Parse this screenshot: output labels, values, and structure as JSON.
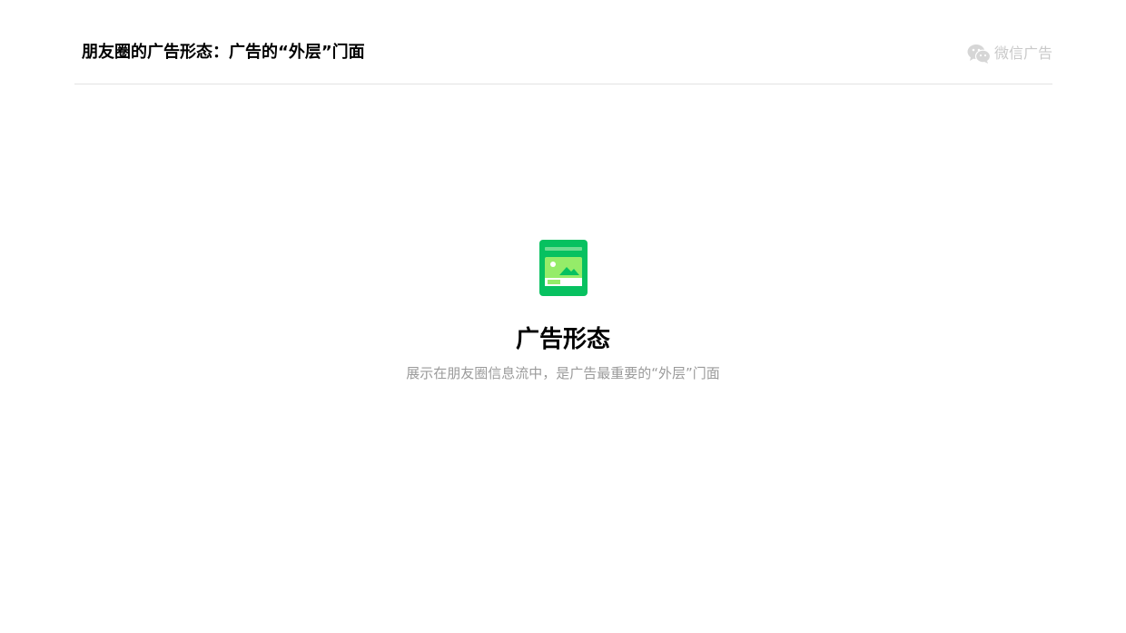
{
  "header": {
    "title": "朋友圈的广告形态：广告的“外层”门面",
    "brand_icon": "wechat-icon",
    "brand_text": "微信广告"
  },
  "hero": {
    "icon": "ad-card-image-icon",
    "title": "广告形态",
    "subtitle": "展示在朋友圈信息流中，是广告最重要的“外层”门面"
  },
  "colors": {
    "accent_green": "#07c160",
    "light_green": "#95ec69",
    "muted_text": "#9a9a9a",
    "divider": "#e3e3e3"
  }
}
